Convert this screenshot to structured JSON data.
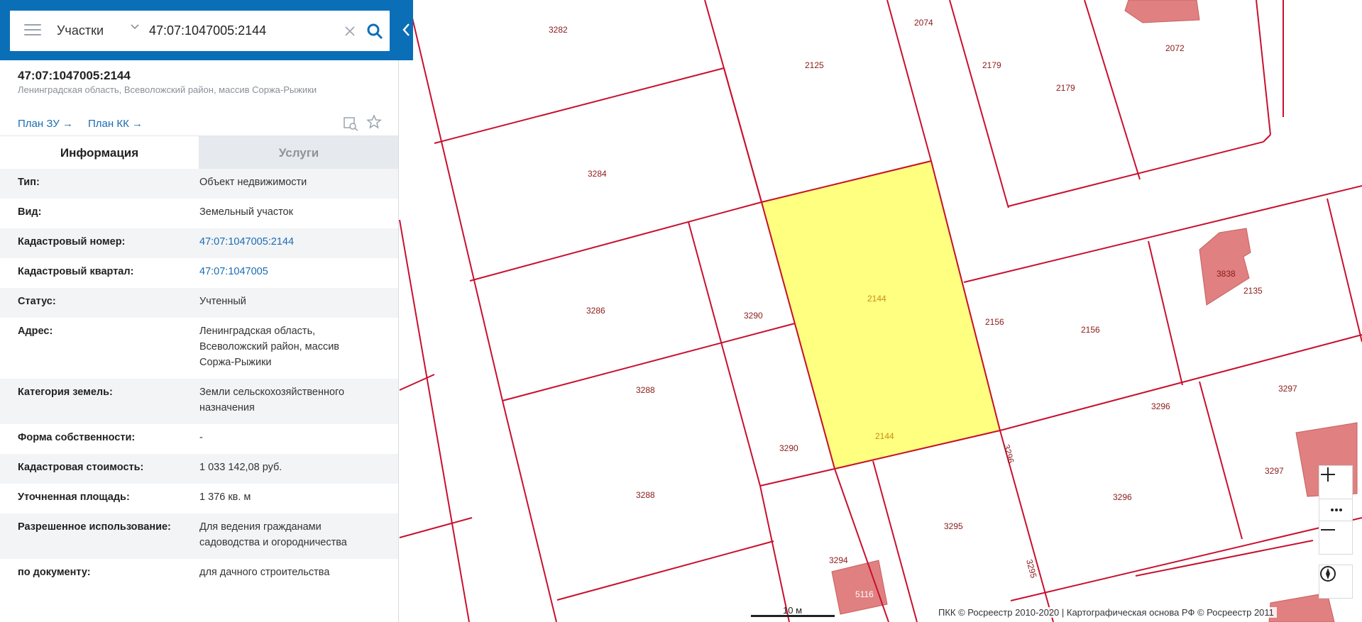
{
  "search": {
    "type_label": "Участки",
    "query": "47:07:1047005:2144"
  },
  "object": {
    "number": "47:07:1047005:2144",
    "address_short": "Ленинградская область, Всеволожский район, массив Соржа-Рыжики",
    "link_plan_zu": "План ЗУ →",
    "link_plan_kk": "План КК →"
  },
  "tabs": {
    "info": "Информация",
    "services": "Услуги"
  },
  "info": [
    {
      "label": "Тип:",
      "value": "Объект недвижимости"
    },
    {
      "label": "Вид:",
      "value": "Земельный участок"
    },
    {
      "label": "Кадастровый номер:",
      "value": "47:07:1047005:2144"
    },
    {
      "label": "Кадастровый квартал:",
      "value": "47:07:1047005"
    },
    {
      "label": "Статус:",
      "value": "Учтенный"
    },
    {
      "label": "Адрес:",
      "value": "Ленинградская область, Всеволожский район, массив Соржа-Рыжики"
    },
    {
      "label": "Категория земель:",
      "value": "Земли сельскохозяйственного назначения"
    },
    {
      "label": "Форма собственности:",
      "value": "-"
    },
    {
      "label": "Кадастровая стоимость:",
      "value": "1 033 142,08 руб."
    },
    {
      "label": "Уточненная площадь:",
      "value": "1 376 кв. м"
    },
    {
      "label": "Разрешенное использование:",
      "value": "Для ведения гражданами садоводства и огородничества"
    },
    {
      "label": "по документу:",
      "value": "для дачного строительства"
    }
  ],
  "map": {
    "parcel_labels": [
      "3282",
      "2125",
      "2074",
      "2179",
      "2179",
      "2072",
      "3284",
      "3286",
      "3290",
      "2144",
      "2156",
      "2156",
      "3838",
      "2135",
      "3288",
      "2144",
      "3290",
      "3296",
      "3296",
      "3297",
      "3288",
      "3295",
      "3295",
      "3296",
      "3297",
      "3294",
      "5116"
    ],
    "highlight_color": "#ffff80",
    "line_color": "#c8102e",
    "building_color": "#e08080",
    "scale_label": "10 м",
    "copyright": "ПКК © Росреестр 2010-2020 | Картографическая основа РФ © Росреестр 2011"
  }
}
